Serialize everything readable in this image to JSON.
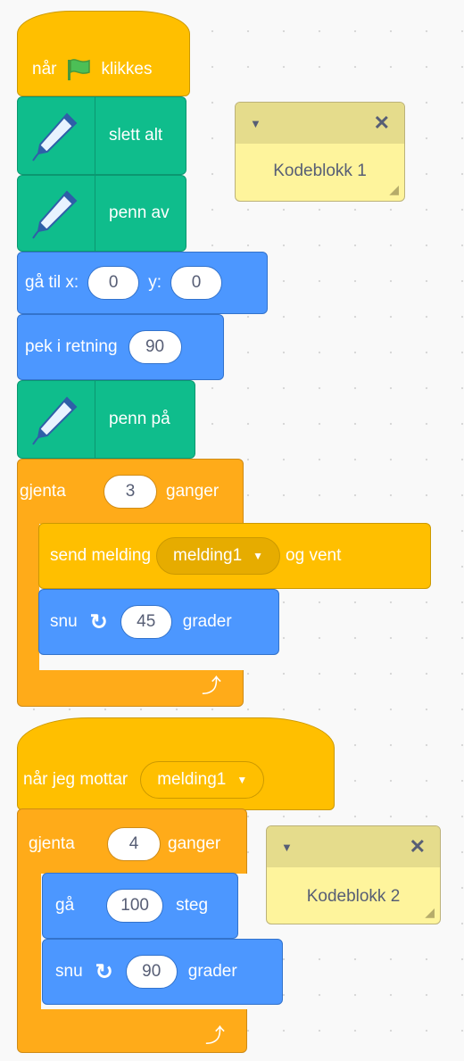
{
  "script1": {
    "when_flag": {
      "pre": "når",
      "post": "klikkes"
    },
    "erase_all": "slett alt",
    "pen_up": "penn av",
    "go_to": {
      "label_x": "gå til x:",
      "x": "0",
      "label_y": "y:",
      "y": "0"
    },
    "point_dir": {
      "label": "pek i retning",
      "value": "90"
    },
    "pen_down": "penn på",
    "repeat": {
      "label": "gjenta",
      "count": "3",
      "suffix": "ganger"
    },
    "broadcast": {
      "label": "send melding",
      "message": "melding1",
      "suffix": "og vent"
    },
    "turn": {
      "label": "snu",
      "value": "45",
      "suffix": "grader"
    }
  },
  "script2": {
    "receive": {
      "label": "når jeg mottar",
      "message": "melding1"
    },
    "repeat": {
      "label": "gjenta",
      "count": "4",
      "suffix": "ganger"
    },
    "move": {
      "label": "gå",
      "value": "100",
      "suffix": "steg"
    },
    "turn": {
      "label": "snu",
      "value": "90",
      "suffix": "grader"
    }
  },
  "comments": [
    {
      "text": "Kodeblokk 1"
    },
    {
      "text": "Kodeblokk 2"
    }
  ],
  "icons": {
    "flag": "green-flag-icon",
    "pen": "pen-icon",
    "rotate": "rotate-right-icon",
    "loop": "loop-arrow-icon",
    "collapse": "chevron-down-icon",
    "close": "close-icon"
  },
  "colors": {
    "events": "#ffbf00",
    "pen": "#0fbd8c",
    "motion": "#4c97ff",
    "control": "#ffab19",
    "comment": "#fef49c"
  }
}
